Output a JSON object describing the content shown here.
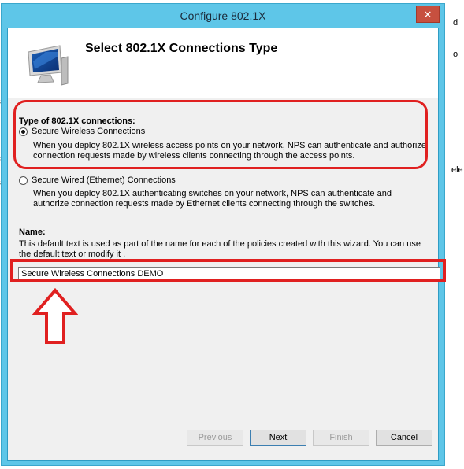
{
  "background": {
    "right_fragments": [
      "d",
      "o",
      "ele"
    ],
    "left_fragments": [
      "a",
      "s",
      "a"
    ]
  },
  "dialog": {
    "title": "Configure 802.1X",
    "close_glyph": "✕"
  },
  "header": {
    "title": "Select 802.1X Connections Type",
    "icon": "computer-monitor-icon"
  },
  "connection_type": {
    "label": "Type of 802.1X connections:",
    "options": [
      {
        "label": "Secure Wireless Connections",
        "checked": true,
        "description": "When you deploy 802.1X wireless access points on your network, NPS can authenticate and authorize connection requests made by wireless clients connecting through the access points."
      },
      {
        "label": "Secure Wired (Ethernet) Connections",
        "checked": false,
        "description": "When you deploy 802.1X authenticating switches on your network, NPS can authenticate and authorize connection requests made by Ethernet clients connecting through the switches."
      }
    ]
  },
  "name_section": {
    "label": "Name:",
    "description": "This default text is used as part of the name for each of the policies created with this wizard. You can use the default text or modify it .",
    "value": "Secure Wireless Connections DEMO"
  },
  "buttons": {
    "previous": "Previous",
    "next": "Next",
    "finish": "Finish",
    "cancel": "Cancel"
  },
  "colors": {
    "title_bar": "#5ec6e8",
    "annotation": "#e02020",
    "close_button": "#c7503f"
  }
}
